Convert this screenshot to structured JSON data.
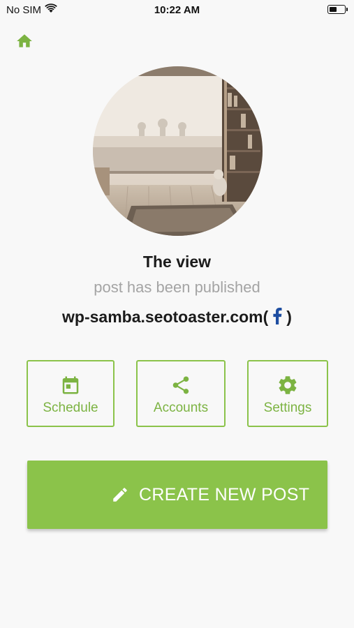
{
  "status_bar": {
    "carrier": "No SIM",
    "time": "10:22 AM",
    "battery_level": 0.55,
    "icons": [
      "wifi-icon",
      "battery-icon"
    ]
  },
  "nav": {
    "home_icon": "home-icon"
  },
  "profile": {
    "title": "The view",
    "status": "post has been published",
    "site": "wp-samba.seotoaster.com",
    "paren_open": "(",
    "paren_close": ")",
    "network_icon": "facebook-icon"
  },
  "actions": [
    {
      "label": "Schedule",
      "icon": "calendar-icon"
    },
    {
      "label": "Accounts",
      "icon": "share-icon"
    },
    {
      "label": "Settings",
      "icon": "gear-icon"
    }
  ],
  "create_button": {
    "label": "CREATE NEW POST",
    "icon": "pencil-icon"
  },
  "colors": {
    "accent": "#8bc34a",
    "accent_text": "#7cb342",
    "background": "#f8f8f8",
    "muted_text": "#a4a4a4",
    "facebook": "#1877f2"
  }
}
